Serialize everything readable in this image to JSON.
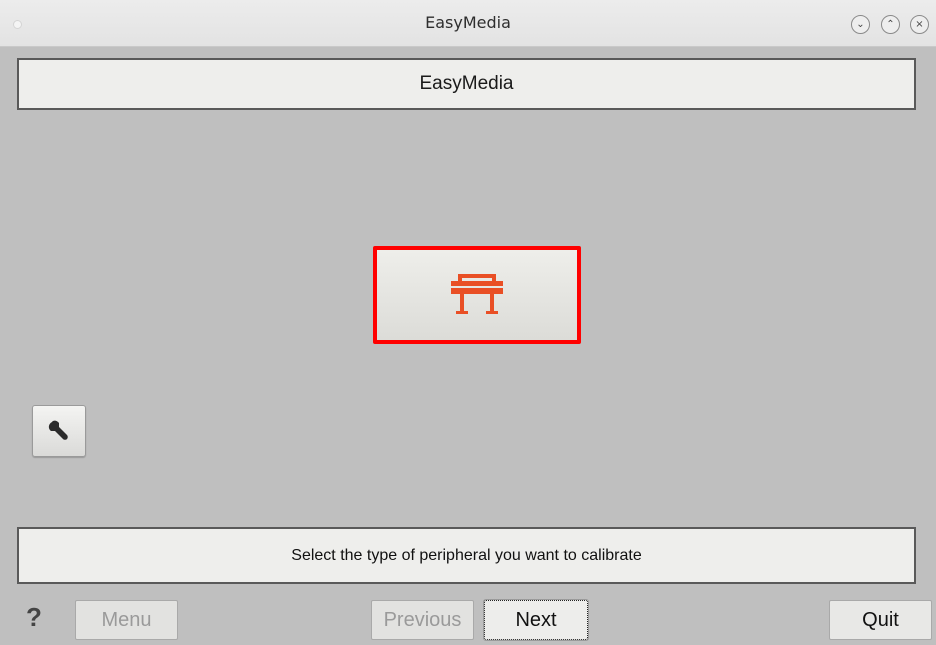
{
  "window": {
    "title": "EasyMedia",
    "controls": [
      "minimize",
      "maximize",
      "close"
    ]
  },
  "header": {
    "title": "EasyMedia"
  },
  "peripheral": {
    "icon": "printer-icon",
    "accent": "#e94f25",
    "highlight": "#ff0000"
  },
  "tools": {
    "icon": "wrench-icon"
  },
  "status": {
    "message": "Select the type of peripheral you want to calibrate"
  },
  "footer": {
    "help_label": "?",
    "menu_label": "Menu",
    "previous_label": "Previous",
    "next_label": "Next",
    "quit_label": "Quit"
  }
}
